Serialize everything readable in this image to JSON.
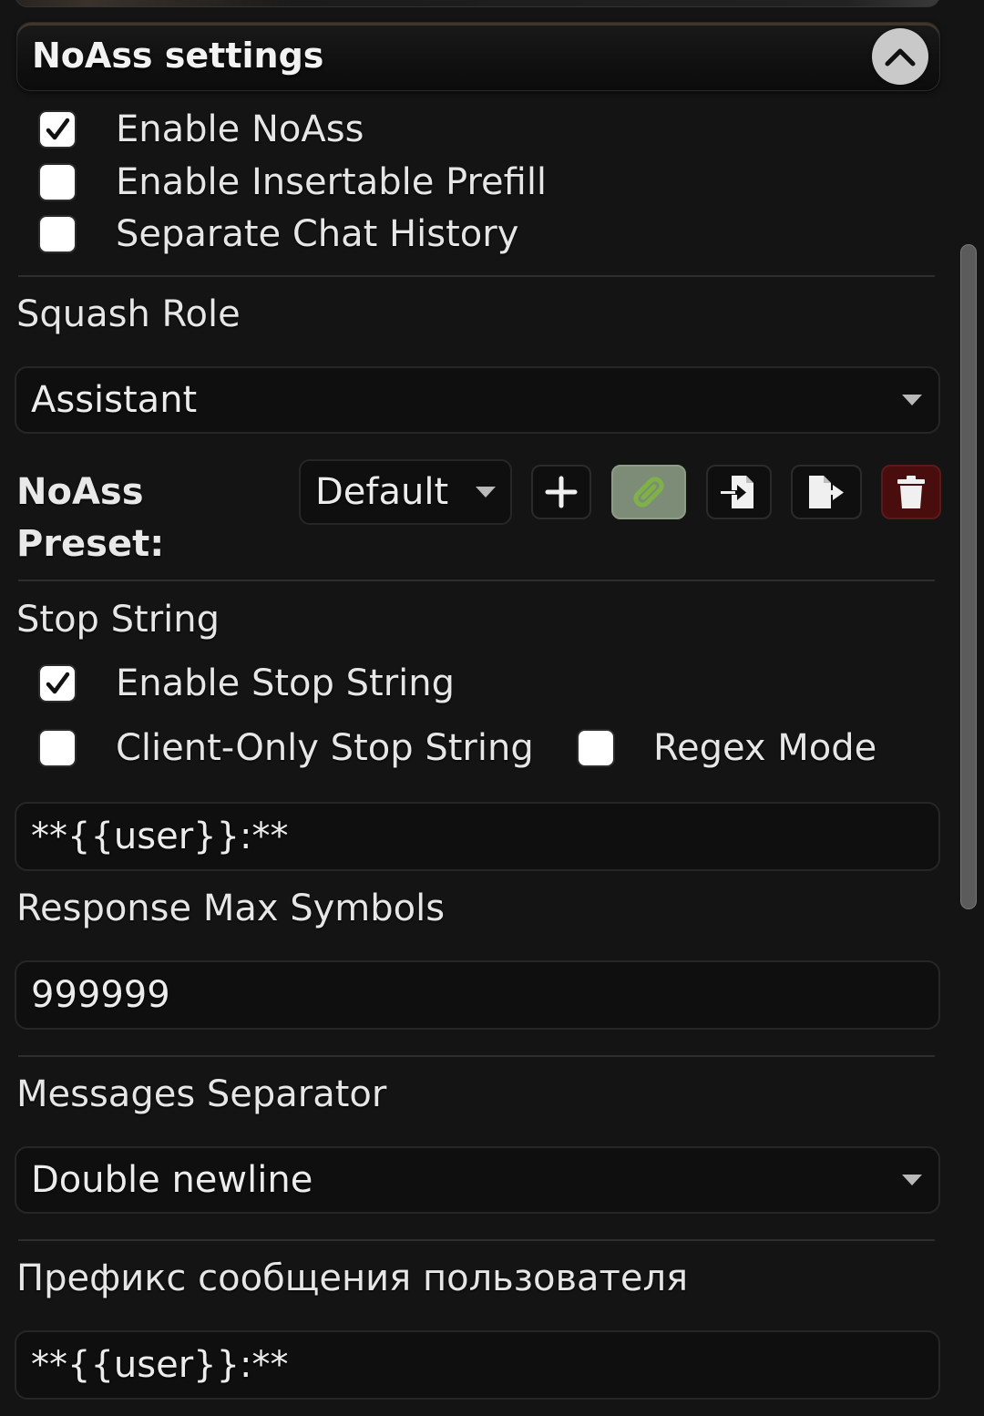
{
  "drawer": {
    "title": "NoAss settings"
  },
  "options": {
    "enable_noass": {
      "label": "Enable NoAss",
      "checked": true
    },
    "enable_insertable_prefill": {
      "label": "Enable Insertable Prefill",
      "checked": false
    },
    "separate_chat_history": {
      "label": "Separate Chat History",
      "checked": false
    }
  },
  "squash_role": {
    "label": "Squash Role",
    "value": "Assistant"
  },
  "preset": {
    "label": "NoAss Preset:",
    "value": "Default",
    "buttons": [
      "add",
      "link",
      "import",
      "export",
      "delete"
    ]
  },
  "stop_string": {
    "label": "Stop String",
    "enable": {
      "label": "Enable Stop String",
      "checked": true
    },
    "client_only": {
      "label": "Client-Only Stop String",
      "checked": false
    },
    "regex_mode": {
      "label": "Regex Mode",
      "checked": false
    },
    "value": "**{{user}}:**"
  },
  "response_max_symbols": {
    "label": "Response Max Symbols",
    "value": "999999"
  },
  "messages_separator": {
    "label": "Messages Separator",
    "value": "Double newline"
  },
  "user_prefix": {
    "label": "Префикс сообщения пользователя",
    "value": "**{{user}}:**"
  },
  "colors": {
    "background": "#141414",
    "link_button_active": "#7c8c76",
    "link_icon": "#7fb04a",
    "delete_button": "#4a0d0d"
  }
}
